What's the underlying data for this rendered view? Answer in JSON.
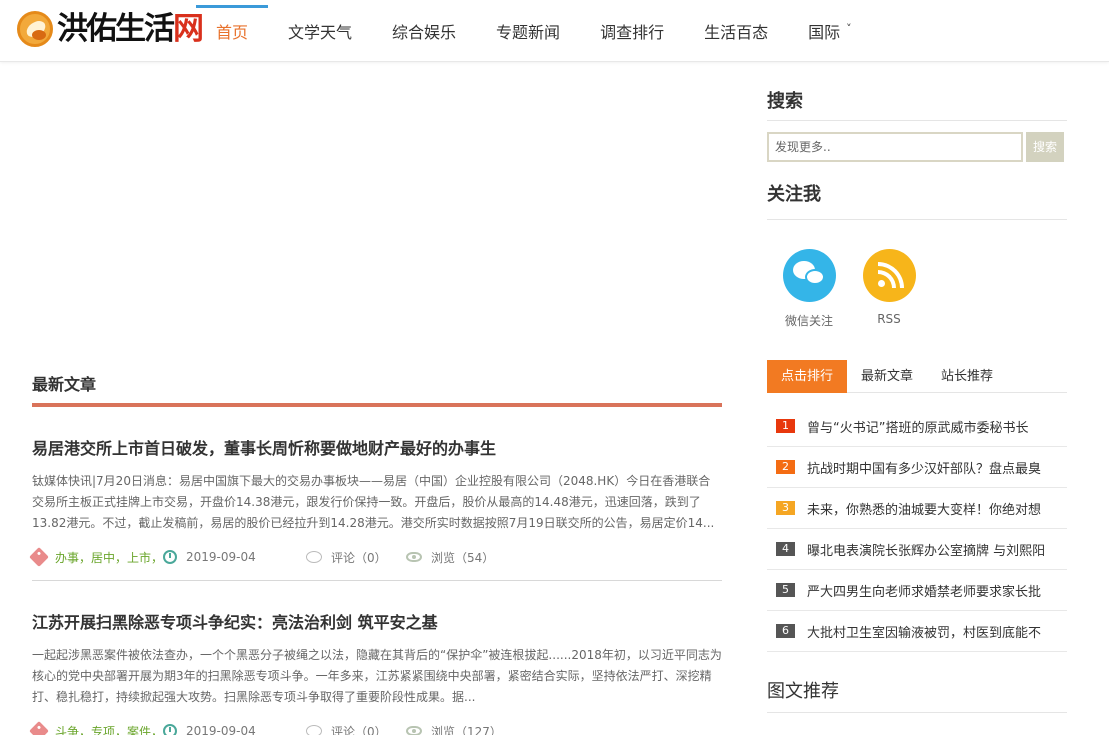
{
  "site": {
    "logo_text_main": "洪佑生活",
    "logo_text_accent": "网"
  },
  "nav": {
    "items": [
      {
        "label": "首页",
        "active": true
      },
      {
        "label": "文学天气",
        "active": false
      },
      {
        "label": "综合娱乐",
        "active": false
      },
      {
        "label": "专题新闻",
        "active": false
      },
      {
        "label": "调查排行",
        "active": false
      },
      {
        "label": "生活百态",
        "active": false
      },
      {
        "label": "国际",
        "active": false,
        "dropdown": true
      }
    ],
    "dropdown_glyph": "˅"
  },
  "main": {
    "section_title": "最新文章",
    "articles": [
      {
        "title": "易居港交所上市首日破发，董事长周忻称要做地财产最好的办事生",
        "summary": "钛媒体快讯|7月20日消息：易居中国旗下最大的交易办事板块——易居（中国）企业控股有限公司（2048.HK）今日在香港联合交易所主板正式挂牌上市交易，开盘价14.38港元，跟发行价保持一致。开盘后，股价从最高的14.48港元，迅速回落，跌到了13.82港元。不过，截止发稿前，易居的股价已经拉升到14.28港元。港交所实时数据按照7月19日联交所的公告，易居定价14...",
        "tags": "办事，居中，上市，",
        "date": "2019-09-04",
        "comments": "评论（0）",
        "views": "浏览（54）"
      },
      {
        "title": "江苏开展扫黑除恶专项斗争纪实：亮法治利剑 筑平安之基",
        "summary": "一起起涉黑恶案件被依法查办，一个个黑恶分子被绳之以法，隐藏在其背后的“保护伞”被连根拔起......2018年初，以习近平同志为核心的党中央部署开展为期3年的扫黑除恶专项斗争。一年多来，江苏紧紧围绕中央部署，紧密结合实际，坚持依法严打、深挖精打、稳扎稳打，持续掀起强大攻势。扫黑除恶专项斗争取得了重要阶段性成果。据...",
        "tags": "斗争，专项，案件，",
        "date": "2019-09-04",
        "comments": "评论（0）",
        "views": "浏览（127）"
      }
    ]
  },
  "sidebar": {
    "search_title": "搜索",
    "search_placeholder": "发现更多..",
    "search_button": "搜索",
    "follow_title": "关注我",
    "follow_items": [
      {
        "label": "微信关注",
        "icon": "wechat-icon",
        "color": "#34b5e8"
      },
      {
        "label": "RSS",
        "icon": "rss-icon",
        "color": "#f7b51a"
      }
    ],
    "tabs": [
      {
        "label": "点击排行",
        "active": true
      },
      {
        "label": "最新文章",
        "active": false
      },
      {
        "label": "站长推荐",
        "active": false
      }
    ],
    "rank_list": [
      {
        "num": "1",
        "color": "#e8380d",
        "text": "曾与“火书记”搭班的原武威市委秘书长"
      },
      {
        "num": "2",
        "color": "#f46c13",
        "text": "抗战时期中国有多少汉奸部队？盘点最臭"
      },
      {
        "num": "3",
        "color": "#f5a623",
        "text": "未来，你熟悉的油城要大变样！你绝对想"
      },
      {
        "num": "4",
        "color": "#555555",
        "text": "曝北电表演院长张辉办公室摘牌 与刘熙阳"
      },
      {
        "num": "5",
        "color": "#555555",
        "text": "严大四男生向老师求婚禁老师要求家长批"
      },
      {
        "num": "6",
        "color": "#555555",
        "text": "大批村卫生室因输液被罚，村医到底能不"
      }
    ],
    "pic_title": "图文推荐"
  },
  "colors": {
    "accent_orange": "#f27a22",
    "nav_active": "#e8722c",
    "nav_indicator": "#3b9ad9",
    "section_underline": "#d9735a",
    "tag_green": "#6aa52b"
  }
}
